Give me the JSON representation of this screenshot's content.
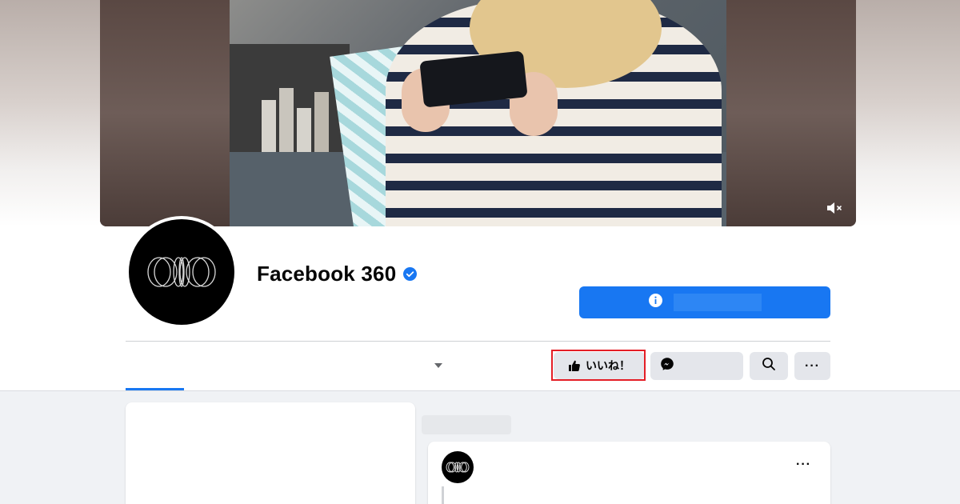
{
  "page": {
    "title": "Facebook 360"
  },
  "actions": {
    "like_label": "いいね！",
    "more_label": "···"
  },
  "post": {
    "more_label": "···"
  },
  "colors": {
    "brand_blue": "#1877f2",
    "highlight_red": "#e41e26",
    "button_gray": "#e4e6eb",
    "background_gray": "#f0f2f5"
  },
  "icons": {
    "verified": "verified-badge-icon",
    "info": "info-icon",
    "like": "thumbs-up-icon",
    "messenger": "messenger-icon",
    "search": "search-icon",
    "more": "more-dots-icon",
    "mute": "muted-speaker-icon",
    "caret": "caret-down-icon"
  }
}
